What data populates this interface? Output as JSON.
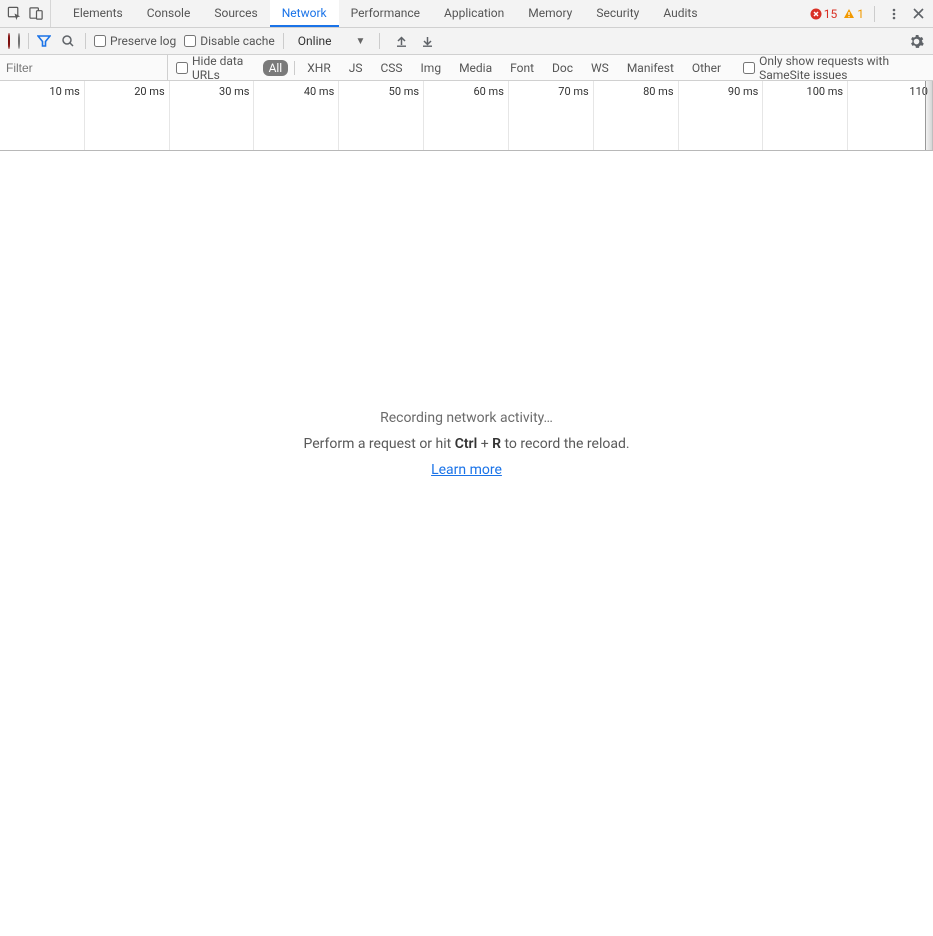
{
  "tabs": [
    "Elements",
    "Console",
    "Sources",
    "Network",
    "Performance",
    "Application",
    "Memory",
    "Security",
    "Audits"
  ],
  "active_tab": "Network",
  "errors": "15",
  "warnings": "1",
  "toolbar": {
    "preserve_log": "Preserve log",
    "disable_cache": "Disable cache",
    "throttle": "Online"
  },
  "filter": {
    "placeholder": "Filter",
    "hide_data_urls": "Hide data URLs",
    "types": [
      "All",
      "XHR",
      "JS",
      "CSS",
      "Img",
      "Media",
      "Font",
      "Doc",
      "WS",
      "Manifest",
      "Other"
    ],
    "active_type": "All",
    "samesite": "Only show requests with SameSite issues"
  },
  "ruler": [
    "10 ms",
    "20 ms",
    "30 ms",
    "40 ms",
    "50 ms",
    "60 ms",
    "70 ms",
    "80 ms",
    "90 ms",
    "100 ms",
    "110"
  ],
  "empty": {
    "title": "Recording network activity…",
    "sub_pre": "Perform a request or hit ",
    "sub_key1": "Ctrl",
    "sub_plus": " + ",
    "sub_key2": "R",
    "sub_post": " to record the reload.",
    "learn_more": "Learn more"
  }
}
